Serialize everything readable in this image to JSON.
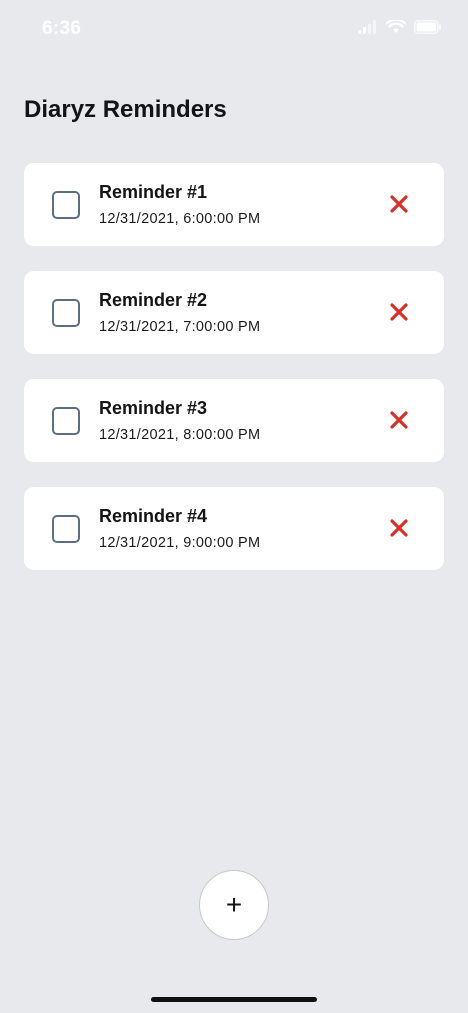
{
  "status_bar": {
    "time": "6:36"
  },
  "header": {
    "title": "Diaryz Reminders"
  },
  "reminders": [
    {
      "title": "Reminder #1",
      "datetime": "12/31/2021, 6:00:00 PM",
      "checked": false
    },
    {
      "title": "Reminder #2",
      "datetime": "12/31/2021, 7:00:00 PM",
      "checked": false
    },
    {
      "title": "Reminder #3",
      "datetime": "12/31/2021, 8:00:00 PM",
      "checked": false
    },
    {
      "title": "Reminder #4",
      "datetime": "12/31/2021, 9:00:00 PM",
      "checked": false
    }
  ],
  "add_button": {
    "label": "+"
  },
  "colors": {
    "background": "#e8e9ed",
    "card": "#ffffff",
    "delete": "#d93025",
    "checkbox_border": "#5b6e84"
  },
  "icons": {
    "signal": "cellular-signal-icon",
    "wifi": "wifi-icon",
    "battery": "battery-icon",
    "delete": "close-icon",
    "checkbox": "checkbox-icon"
  }
}
